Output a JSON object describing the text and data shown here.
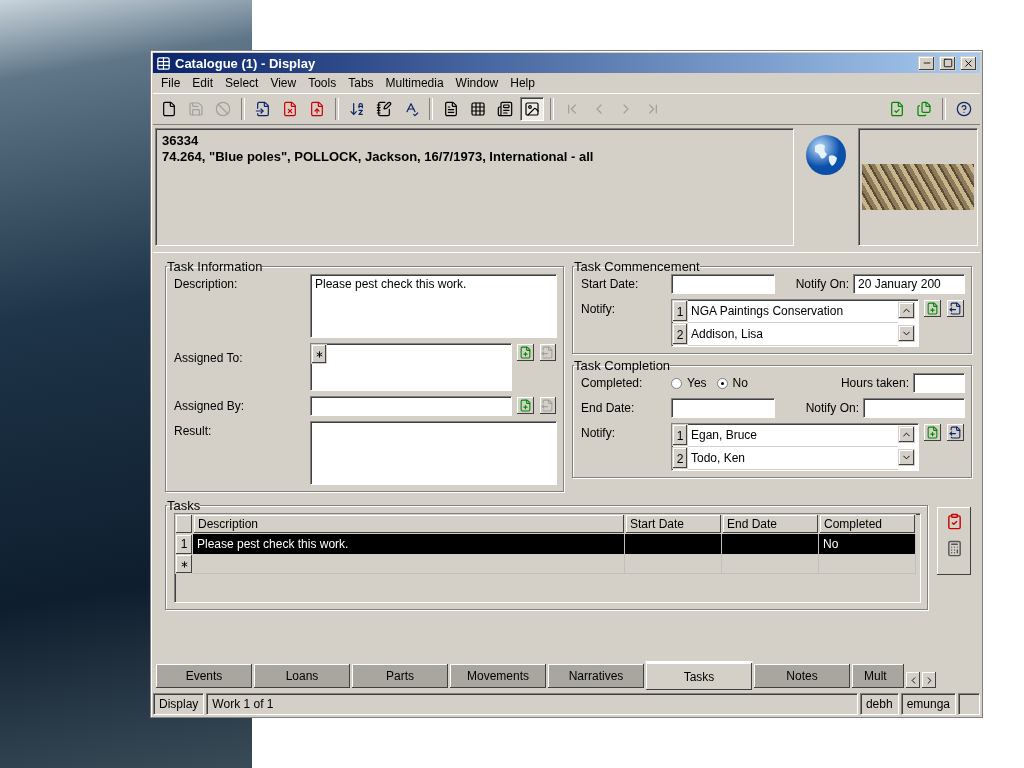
{
  "window": {
    "title": "Catalogue (1) - Display"
  },
  "menu": [
    "File",
    "Edit",
    "Select",
    "View",
    "Tools",
    "Tabs",
    "Multimedia",
    "Window",
    "Help"
  ],
  "toolbar": [
    {
      "kind": "new",
      "disabled": false
    },
    {
      "kind": "save",
      "disabled": true
    },
    {
      "kind": "cancel",
      "disabled": true
    },
    {
      "kind": "separator"
    },
    {
      "kind": "open",
      "disabled": false
    },
    {
      "kind": "remove",
      "disabled": false
    },
    {
      "kind": "export",
      "disabled": false
    },
    {
      "kind": "separator"
    },
    {
      "kind": "sort",
      "disabled": false
    },
    {
      "kind": "edit",
      "disabled": false
    },
    {
      "kind": "spell",
      "disabled": false
    },
    {
      "kind": "separator"
    },
    {
      "kind": "page",
      "disabled": false,
      "selected": false
    },
    {
      "kind": "grid",
      "disabled": false,
      "selected": false
    },
    {
      "kind": "card",
      "disabled": false,
      "selected": false
    },
    {
      "kind": "image",
      "disabled": false,
      "selected": true
    },
    {
      "kind": "separator"
    },
    {
      "kind": "first",
      "disabled": true
    },
    {
      "kind": "previous",
      "disabled": true
    },
    {
      "kind": "next",
      "disabled": true
    },
    {
      "kind": "last",
      "disabled": true
    },
    {
      "kind": "spacer"
    },
    {
      "kind": "copy",
      "disabled": false
    },
    {
      "kind": "copies",
      "disabled": false
    },
    {
      "kind": "separator"
    },
    {
      "kind": "help",
      "disabled": false
    }
  ],
  "record": {
    "number": "36334",
    "summary": "74.264, \"Blue poles\", POLLOCK, Jackson, 16/7/1973, International - all"
  },
  "task_information": {
    "title": "Task Information",
    "description_label": "Description:",
    "description": "Please pest check this work.",
    "assigned_to_label": "Assigned To:",
    "assigned_by_label": "Assigned By:",
    "result_label": "Result:"
  },
  "task_commencement": {
    "title": "Task Commencement",
    "start_date_label": "Start Date:",
    "notify_on_label": "Notify On:",
    "notify_on": "20 January 200",
    "notify_label": "Notify:",
    "notify": [
      {
        "number": "1",
        "name": "NGA Paintings Conservation"
      },
      {
        "number": "2",
        "name": "Addison, Lisa"
      }
    ]
  },
  "task_completion": {
    "title": "Task Completion",
    "completed_label": "Completed:",
    "options": [
      {
        "label": "Yes",
        "selected": false
      },
      {
        "label": "No",
        "selected": true
      }
    ],
    "hours_label": "Hours taken:",
    "end_date_label": "End Date:",
    "notify_on_label": "Notify On:",
    "notify_label": "Notify:",
    "notify": [
      {
        "number": "1",
        "name": "Egan, Bruce"
      },
      {
        "number": "2",
        "name": "Todo, Ken"
      }
    ]
  },
  "tasks": {
    "title": "Tasks",
    "columns": [
      "Description",
      "Start Date",
      "End Date",
      "Completed"
    ],
    "rows": [
      {
        "number": "1",
        "description": "Please pest check this work.",
        "completed": "No",
        "selected": true
      }
    ]
  },
  "tabs": [
    {
      "label": "Events",
      "selected": false
    },
    {
      "label": "Loans",
      "selected": false
    },
    {
      "label": "Parts",
      "selected": false
    },
    {
      "label": "Movements",
      "selected": false
    },
    {
      "label": "Narratives",
      "selected": false
    },
    {
      "label": "Tasks",
      "selected": true
    },
    {
      "label": "Notes",
      "selected": false
    },
    {
      "label": "Mult",
      "selected": false
    }
  ],
  "status_bar": [
    "Display",
    "Work 1 of 1",
    "debh",
    "emunga"
  ]
}
